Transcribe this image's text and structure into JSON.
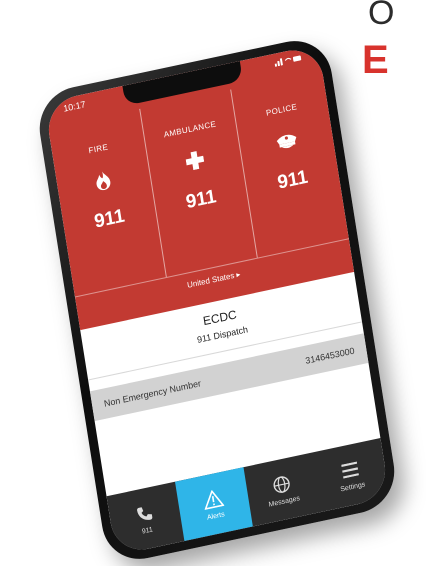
{
  "corner_heading": {
    "top_fragment": "O",
    "red_fragment": "E"
  },
  "status_bar": {
    "time": "10:17",
    "icons": "signal-icon wifi-icon battery-icon"
  },
  "services": [
    {
      "label": "FIRE",
      "number": "911",
      "icon": "flame-icon"
    },
    {
      "label": "AMBULANCE",
      "number": "911",
      "icon": "cross-icon"
    },
    {
      "label": "POLICE",
      "number": "911",
      "icon": "police-cap-icon"
    }
  ],
  "region": {
    "label": "United States ▸"
  },
  "agency": {
    "name": "ECDC",
    "subtitle": "911 Dispatch"
  },
  "non_emergency": {
    "label": "Non Emergency Number",
    "number": "3146453000"
  },
  "tabs": [
    {
      "label": "911",
      "icon": "phone-icon",
      "active": false
    },
    {
      "label": "Alerts",
      "icon": "warning-icon",
      "active": true
    },
    {
      "label": "Messages",
      "icon": "globe-icon",
      "active": false
    },
    {
      "label": "Settings",
      "icon": "menu-icon",
      "active": false
    }
  ],
  "colors": {
    "header_red": "#c23a32",
    "active_tab": "#2fb5e8",
    "tab_bar": "#2d2d2d",
    "brand_red": "#d8332d"
  }
}
